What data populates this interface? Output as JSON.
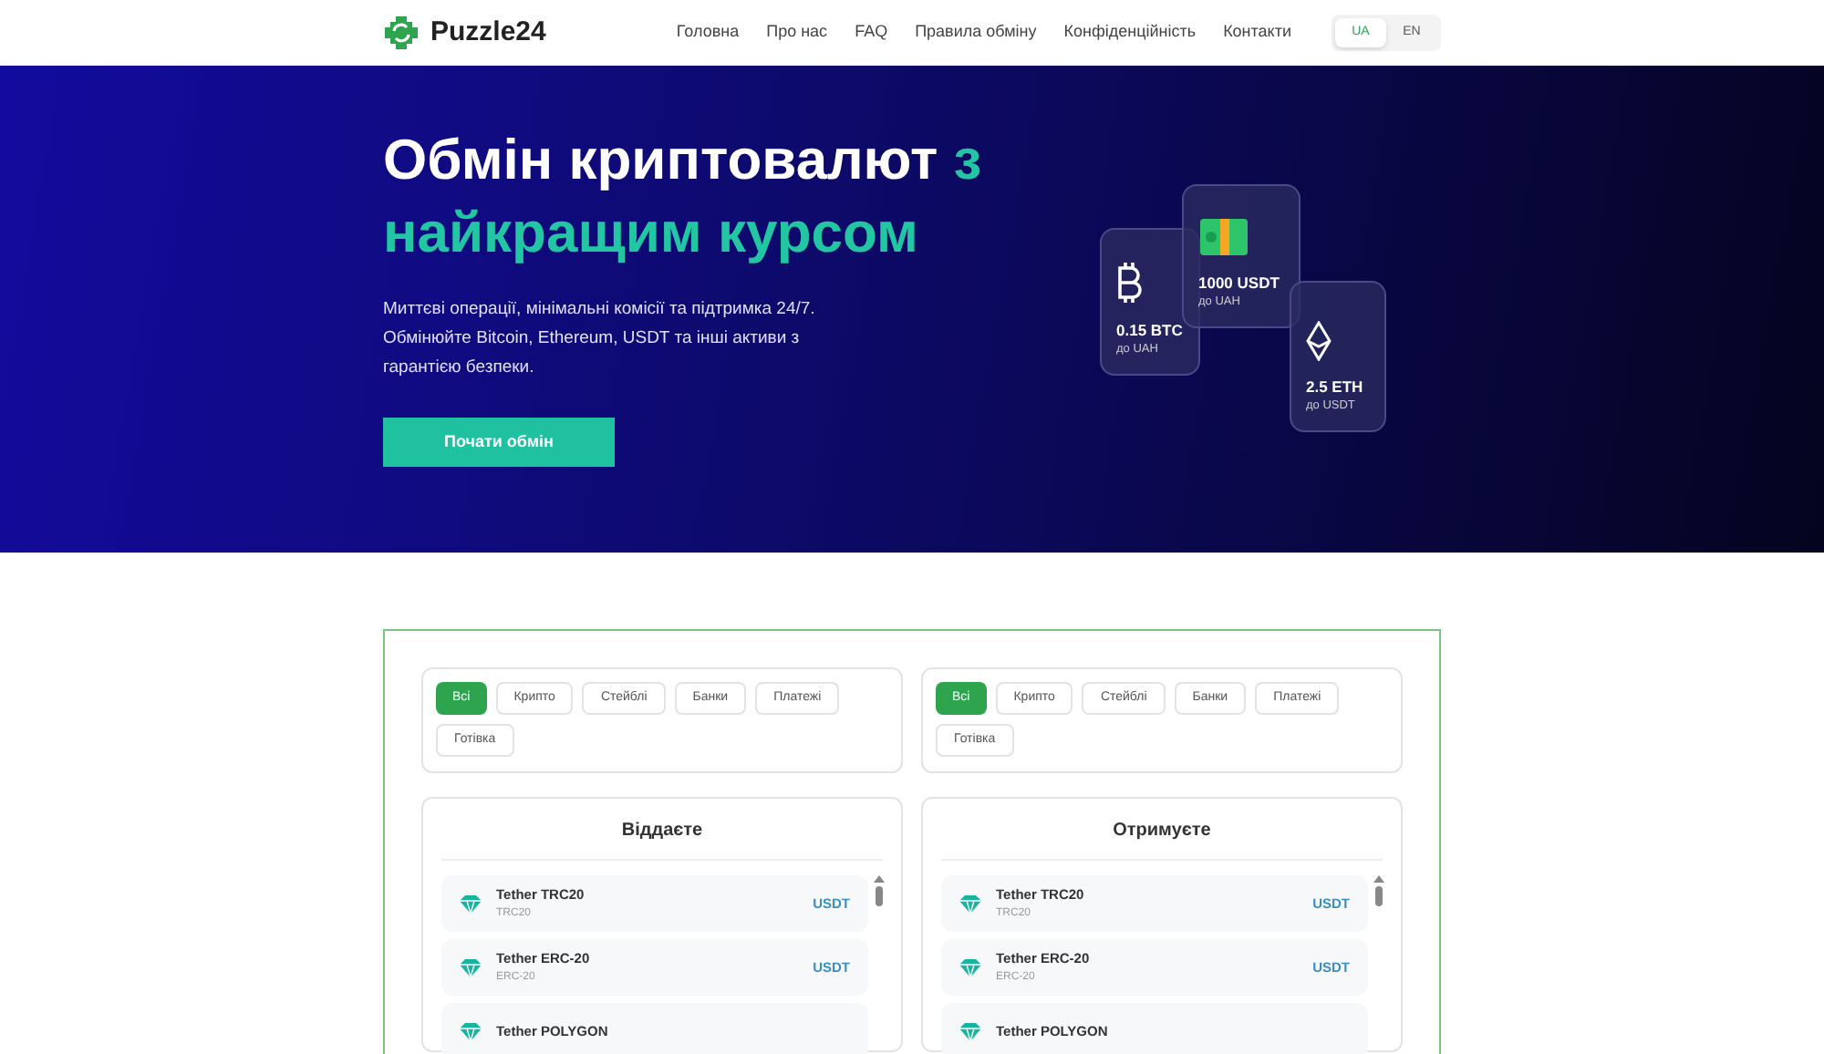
{
  "brand": "Puzzle24",
  "nav": [
    "Головна",
    "Про нас",
    "FAQ",
    "Правила обміну",
    "Конфіденційність",
    "Контакти"
  ],
  "languages": [
    {
      "label": "UA",
      "selected": true
    },
    {
      "label": "EN",
      "selected": false
    }
  ],
  "hero": {
    "title_white": "Обмін криптовалют",
    "title_accent": "з найкращим курсом",
    "description": "Миттєві операції, мінімальні комісії та підтримка 24/7. Обмінюйте Bitcoin, Ethereum, USDT та інші активи з гарантією безпеки.",
    "button": "Почати обмін"
  },
  "hero_cards": [
    {
      "kind": "bitcoin",
      "amount": "0.15 BTC",
      "target": "до UAH"
    },
    {
      "kind": "cash",
      "amount": "1000 USDT",
      "target": "до UAH"
    },
    {
      "kind": "ethereum",
      "amount": "2.5 ETH",
      "target": "до USDT"
    }
  ],
  "filters": [
    {
      "options": [
        {
          "label": "Всі",
          "selected": true
        },
        {
          "label": "Крипто",
          "selected": false
        },
        {
          "label": "Стейблі",
          "selected": false
        },
        {
          "label": "Банки",
          "selected": false
        },
        {
          "label": "Платежі",
          "selected": false
        },
        {
          "label": "Готівка",
          "selected": false
        }
      ]
    },
    {
      "options": [
        {
          "label": "Всі",
          "selected": true
        },
        {
          "label": "Крипто",
          "selected": false
        },
        {
          "label": "Стейблі",
          "selected": false
        },
        {
          "label": "Банки",
          "selected": false
        },
        {
          "label": "Платежі",
          "selected": false
        },
        {
          "label": "Готівка",
          "selected": false
        }
      ]
    }
  ],
  "columns": [
    {
      "title": "Віддаєте",
      "currencies": [
        {
          "name": "Tether TRC20",
          "network": "TRC20",
          "code": "USDT"
        },
        {
          "name": "Tether ERC-20",
          "network": "ERC-20",
          "code": "USDT"
        },
        {
          "name": "Tether POLYGON"
        }
      ]
    },
    {
      "title": "Отримуєте",
      "currencies": [
        {
          "name": "Tether TRC20",
          "network": "TRC20",
          "code": "USDT"
        },
        {
          "name": "Tether ERC-20",
          "network": "ERC-20",
          "code": "USDT"
        },
        {
          "name": "Tether POLYGON"
        }
      ]
    }
  ]
}
